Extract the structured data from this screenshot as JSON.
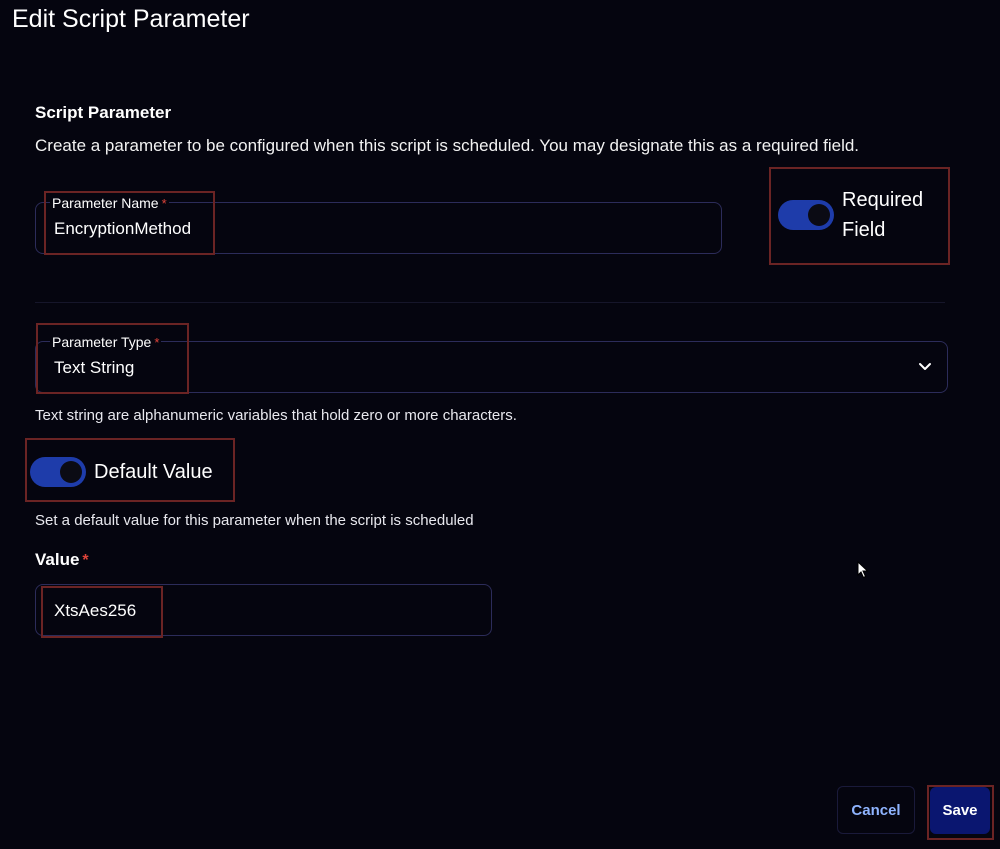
{
  "dialog": {
    "title": "Edit Script Parameter"
  },
  "section": {
    "title": "Script Parameter",
    "description": "Create a parameter to be configured when this script is scheduled. You may designate this as a required field."
  },
  "parameter_name": {
    "label": "Parameter Name",
    "required_marker": "*",
    "value": "EncryptionMethod"
  },
  "required_field": {
    "label_line1": "Required",
    "label_line2": "Field",
    "enabled": true
  },
  "parameter_type": {
    "label": "Parameter Type",
    "required_marker": "*",
    "selected": "Text String",
    "helper": "Text string are alphanumeric variables that hold zero or more characters.",
    "icon": "chevron-down-icon"
  },
  "default_value": {
    "label": "Default Value",
    "enabled": true,
    "helper": "Set a default value for this parameter when the script is scheduled"
  },
  "value_field": {
    "label": "Value",
    "required_marker": "*",
    "value": "XtsAes256"
  },
  "actions": {
    "cancel_label": "Cancel",
    "save_label": "Save"
  },
  "colors": {
    "background": "#05050f",
    "toggle_on": "#1e3caa",
    "required_star": "#e0443a",
    "cancel_text": "#8fb4ff",
    "save_bg": "#0a1670",
    "annotation": "#6b2424"
  }
}
